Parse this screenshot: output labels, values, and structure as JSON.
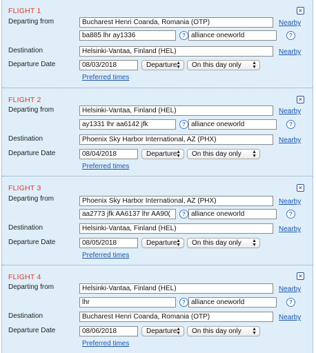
{
  "labels": {
    "departing_from": "Departing from",
    "destination": "Destination",
    "departure_date": "Departure Date",
    "nearby": "Nearby",
    "preferred_times": "Preferred times",
    "departure_select": "Departure",
    "day_select": "On this day only",
    "close_glyph": "×",
    "help_glyph": "?"
  },
  "flights": [
    {
      "title": "FLIGHT 1",
      "from": "Bucharest Henri Coanda, Romania (OTP)",
      "flights_input": "ba885 lhr ay1336",
      "alliance": "alliance oneworld",
      "destination": "Helsinki-Vantaa, Finland (HEL)",
      "date": "08/03/2018"
    },
    {
      "title": "FLIGHT 2",
      "from": "Helsinki-Vantaa, Finland (HEL)",
      "flights_input": "ay1331 lhr aa6142 jfk",
      "alliance": "alliance oneworld",
      "destination": "Phoenix Sky Harbor International, AZ (PHX)",
      "date": "08/04/2018"
    },
    {
      "title": "FLIGHT 3",
      "from": "Phoenix Sky Harbor International, AZ (PHX)",
      "flights_input": "aa2773 jfk AA6137 lhr AA90(",
      "alliance": "alliance oneworld",
      "destination": "Helsinki-Vantaa, Finland (HEL)",
      "date": "08/05/2018"
    },
    {
      "title": "FLIGHT 4",
      "from": "Helsinki-Vantaa, Finland (HEL)",
      "flights_input": "lhr",
      "alliance": "alliance oneworld",
      "destination": "Bucharest Henri Coanda, Romania (OTP)",
      "date": "08/06/2018"
    }
  ]
}
